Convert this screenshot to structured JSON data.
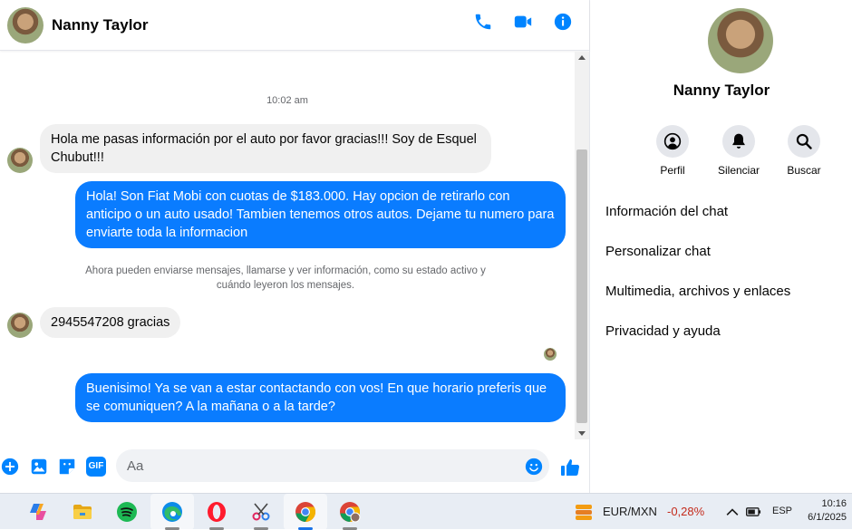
{
  "header": {
    "contact_name": "Nanny Taylor",
    "icons": [
      "phone-icon",
      "video-icon",
      "info-icon"
    ]
  },
  "conversation": {
    "timestamp": "10:02 am",
    "messages": [
      {
        "from": "them",
        "text": "Hola me pasas información por el auto por favor gracias!!! Soy de Esquel Chubut!!!"
      },
      {
        "from": "me",
        "text": "Hola! Son Fiat Mobi con cuotas de $183.000. Hay opcion de retirarlo con anticipo o un auto usado! Tambien tenemos otros autos. Dejame tu numero para enviarte toda la informacion"
      },
      {
        "from": "them",
        "text": "2945547208 gracias"
      },
      {
        "from": "me",
        "text": "Buenisimo! Ya se van a estar contactando con vos! En que horario preferis que se comuniquen? A la mañana o a la tarde?"
      }
    ],
    "notice": "Ahora pueden enviarse mensajes, llamarse y ver información, como su estado activo y cuándo leyeron los mensajes."
  },
  "composer": {
    "placeholder": "Aa",
    "icons": [
      "plus-icon",
      "gallery-icon",
      "sticker-icon",
      "gif-icon",
      "emoji-icon",
      "like-icon"
    ],
    "gif_label": "GIF"
  },
  "profile": {
    "name": "Nanny Taylor",
    "actions": [
      {
        "label": "Perfil",
        "icon": "profile-icon"
      },
      {
        "label": "Silenciar",
        "icon": "bell-icon"
      },
      {
        "label": "Buscar",
        "icon": "search-icon"
      }
    ],
    "menu": [
      "Información del chat",
      "Personalizar chat",
      "Multimedia, archivos y enlaces",
      "Privacidad y ayuda"
    ]
  },
  "taskbar": {
    "apps": [
      "copilot-icon",
      "file-explorer-icon",
      "spotify-icon",
      "edge-icon",
      "opera-icon",
      "snipping-tool-icon",
      "chrome-icon",
      "chrome-profile-icon"
    ],
    "ticker": {
      "symbol": "EUR/MXN",
      "change": "-0,28%"
    },
    "language": "ESP",
    "time": "10:16",
    "date": "6/1/2025"
  },
  "colors": {
    "accent": "#0084ff",
    "bubble_out": "#0a7cff",
    "bubble_in": "#f0f0f0",
    "negative": "#c42b1c"
  }
}
